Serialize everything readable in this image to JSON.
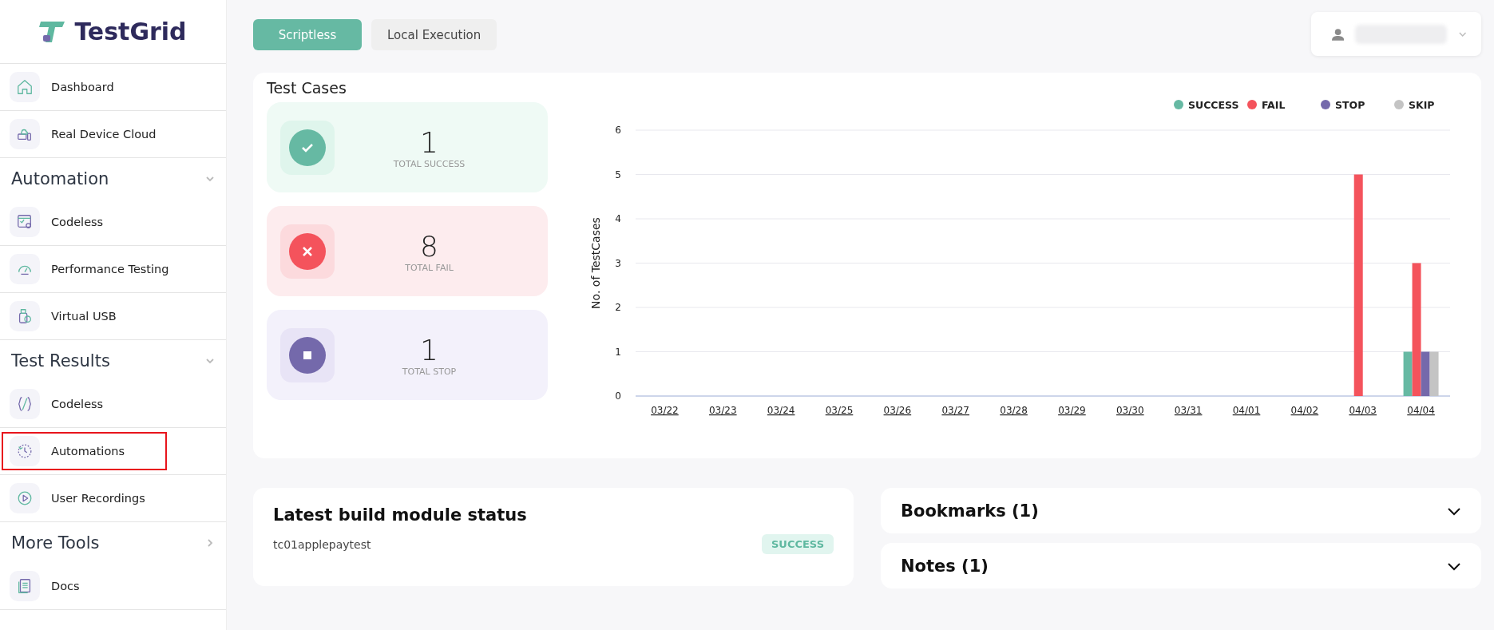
{
  "sidebar": {
    "logo": "TestGrid",
    "groups": [
      {
        "items": [
          {
            "label": "Dashboard",
            "highlighted": false
          },
          {
            "label": "Real Device Cloud",
            "highlighted": false
          }
        ]
      },
      {
        "title": "Automation",
        "expanded": true,
        "items": [
          {
            "label": "Codeless",
            "highlighted": false
          },
          {
            "label": "Performance Testing",
            "highlighted": false
          },
          {
            "label": "Virtual USB",
            "highlighted": false
          }
        ]
      },
      {
        "title": "Test Results",
        "expanded": true,
        "items": [
          {
            "label": "Codeless",
            "highlighted": false
          },
          {
            "label": "Automations",
            "highlighted": true
          },
          {
            "label": "User Recordings",
            "highlighted": false
          }
        ]
      },
      {
        "title": "More Tools",
        "expanded": false,
        "items": [
          {
            "label": "Docs",
            "highlighted": false
          }
        ]
      }
    ]
  },
  "tabs": [
    {
      "label": "Scriptless",
      "selected": true
    },
    {
      "label": "Local Execution",
      "selected": false
    }
  ],
  "test_cases": {
    "title": "Test Cases",
    "stats": [
      {
        "kind": "success",
        "value": "1",
        "label": "TOTAL SUCCESS"
      },
      {
        "kind": "fail",
        "value": "8",
        "label": "TOTAL FAIL"
      },
      {
        "kind": "stop",
        "value": "1",
        "label": "TOTAL STOP"
      }
    ],
    "chart_data": {
      "type": "bar",
      "grid": true,
      "legend": true,
      "ylabel": "No. of TestCases",
      "categories": [
        "03/22",
        "03/23",
        "03/24",
        "03/25",
        "03/26",
        "03/27",
        "03/28",
        "03/29",
        "03/30",
        "03/31",
        "04/01",
        "04/02",
        "04/03",
        "04/04"
      ],
      "ylim": [
        0,
        6
      ],
      "yticks": [
        0,
        1,
        2,
        3,
        4,
        5,
        6
      ],
      "series": [
        {
          "name": "SUCCESS",
          "color": "#66b9a3",
          "values": [
            0,
            0,
            0,
            0,
            0,
            0,
            0,
            0,
            0,
            0,
            0,
            0,
            0,
            1
          ]
        },
        {
          "name": "FAIL",
          "color": "#f4535c",
          "values": [
            0,
            0,
            0,
            0,
            0,
            0,
            0,
            0,
            0,
            0,
            0,
            0,
            5,
            3
          ]
        },
        {
          "name": "STOP",
          "color": "#7469ab",
          "values": [
            0,
            0,
            0,
            0,
            0,
            0,
            0,
            0,
            0,
            0,
            0,
            0,
            0,
            1
          ]
        },
        {
          "name": "SKIP",
          "color": "#c4c4c4",
          "values": [
            0,
            0,
            0,
            0,
            0,
            0,
            0,
            0,
            0,
            0,
            0,
            0,
            0,
            1
          ]
        }
      ]
    }
  },
  "build_status": {
    "title": "Latest build module status",
    "name": "tc01applepaytest",
    "status": "SUCCESS"
  },
  "panels": [
    {
      "title": "Bookmarks (1)",
      "expanded": false
    },
    {
      "title": "Notes (1)",
      "expanded": false
    }
  ]
}
